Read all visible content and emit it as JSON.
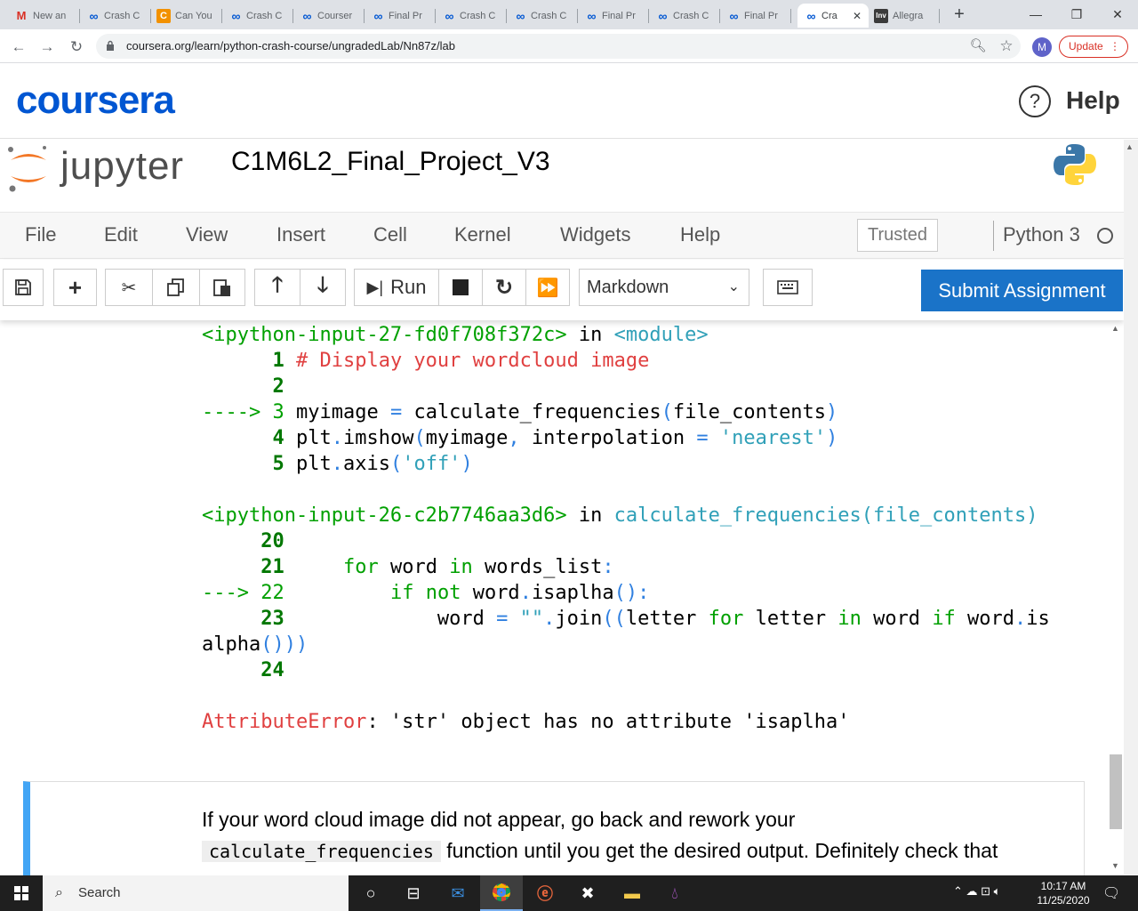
{
  "browser": {
    "tabs": [
      {
        "label": "New an",
        "icon": "gmail-icon",
        "active": false
      },
      {
        "label": "Crash C",
        "icon": "coursera-icon",
        "active": false
      },
      {
        "label": "Can You",
        "icon": "cyeoma-icon",
        "active": false
      },
      {
        "label": "Crash C",
        "icon": "coursera-icon",
        "active": false
      },
      {
        "label": "Courser",
        "icon": "coursera-icon",
        "active": false
      },
      {
        "label": "Final Pr",
        "icon": "coursera-icon",
        "active": false
      },
      {
        "label": "Crash C",
        "icon": "coursera-icon",
        "active": false
      },
      {
        "label": "Crash C",
        "icon": "coursera-icon",
        "active": false
      },
      {
        "label": "Final Pr",
        "icon": "coursera-icon",
        "active": false
      },
      {
        "label": "Crash C",
        "icon": "coursera-icon",
        "active": false
      },
      {
        "label": "Final Pr",
        "icon": "coursera-icon",
        "active": false
      },
      {
        "label": "Cra",
        "icon": "coursera-icon",
        "active": true
      },
      {
        "label": "Allegra",
        "icon": "invision-icon",
        "active": false
      }
    ],
    "url": "coursera.org/learn/python-crash-course/ungradedLab/Nn87z/lab",
    "avatar_letter": "M",
    "update_label": "Update"
  },
  "coursera": {
    "logo": "coursera",
    "help_label": "Help"
  },
  "jupyter": {
    "brand": "jupyter",
    "notebook_title": "C1M6L2_Final_Project_V3",
    "menu": [
      "File",
      "Edit",
      "View",
      "Insert",
      "Cell",
      "Kernel",
      "Widgets",
      "Help"
    ],
    "trusted_label": "Trusted",
    "kernel_name": "Python 3",
    "run_label": "Run",
    "cell_type": "Markdown",
    "submit_label": "Submit Assignment"
  },
  "traceback": {
    "frame1_header": "<ipython-input-27-fd0f708f372c>",
    "frame1_in": "in",
    "frame1_module": "<module>",
    "frame2_header": "<ipython-input-26-c2b7746aa3d6>",
    "frame2_in": "in",
    "frame2_func": "calculate_frequencies(file_contents)",
    "error_name": "AttributeError",
    "error_msg": ": 'str' object has no attribute 'isaplha'"
  },
  "markdown": {
    "line1": "If your word cloud image did not appear, go back and rework your",
    "code1": "calculate_frequencies",
    "line2": " function until you get the desired output. Definitely check that"
  },
  "taskbar": {
    "search_placeholder": "Search",
    "time": "10:17 AM",
    "date": "11/25/2020"
  },
  "colors": {
    "coursera_blue": "#0056d2",
    "submit_blue": "#1a73c8",
    "traceback_green": "#00a000",
    "error_red": "#e04040",
    "md_border": "#42a5f5"
  }
}
